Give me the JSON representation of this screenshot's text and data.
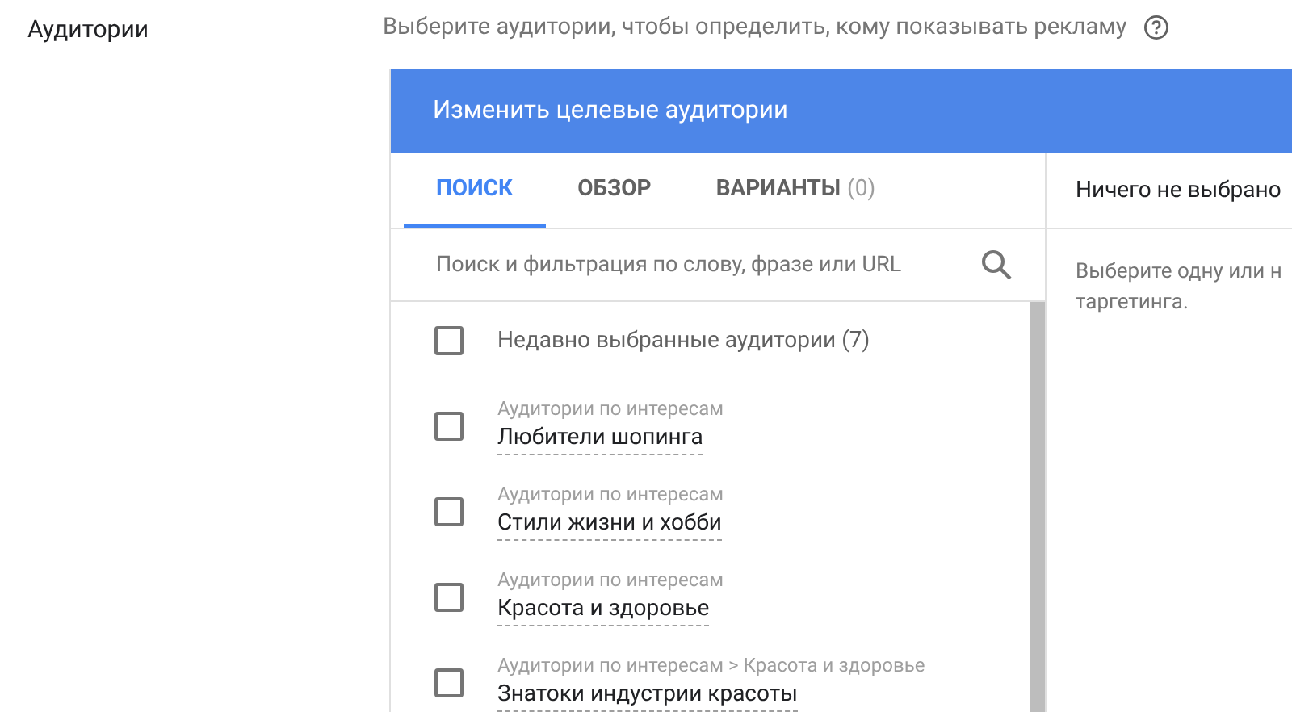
{
  "section_label": "Аудитории",
  "description": "Выберите аудитории, чтобы определить, кому показывать рекламу",
  "panel": {
    "title": "Изменить целевые аудитории",
    "tabs": [
      {
        "label": "ПОИСК",
        "selected": true
      },
      {
        "label": "ОБЗОР",
        "selected": false
      },
      {
        "label": "ВАРИАНТЫ",
        "count": "(0)",
        "selected": false
      }
    ],
    "search": {
      "placeholder": "Поиск и фильтрация по слову, фразе или URL"
    },
    "items": [
      {
        "kind": "plain",
        "label": "Недавно выбранные аудитории (7)",
        "checked": false
      },
      {
        "kind": "category",
        "category": "Аудитории по интересам",
        "label": "Любители шопинга",
        "checked": false
      },
      {
        "kind": "category",
        "category": "Аудитории по интересам",
        "label": "Стили жизни и хобби",
        "checked": false
      },
      {
        "kind": "category",
        "category": "Аудитории по интересам",
        "label": "Красота и здоровье",
        "checked": false
      },
      {
        "kind": "category",
        "category": "Аудитории по интересам > Красота и здоровье",
        "label": "Знатоки индустрии красоты",
        "checked": false
      }
    ],
    "selected_panel": {
      "title": "Ничего не выбрано",
      "hint_lines": [
        "Выберите одну или н",
        "таргетинга."
      ]
    }
  }
}
